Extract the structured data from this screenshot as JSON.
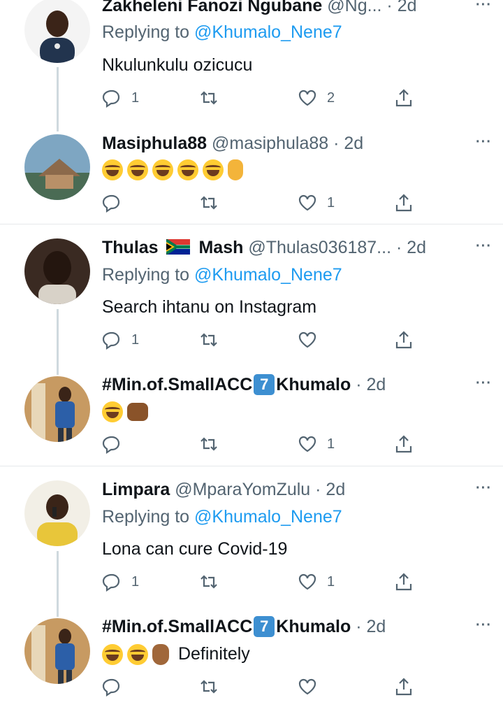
{
  "tweets": [
    {
      "name": "Zakheleni Fanozi Ngubane",
      "handle": "@Ng...",
      "time": "· 2d",
      "replying_prefix": "Replying to ",
      "replying_to": "@Khumalo_Nene7",
      "text": "Nkulunkulu ozicucu",
      "replies": "1",
      "retweets": "",
      "likes": "2"
    },
    {
      "name": "Masiphula88",
      "handle": "@masiphula88",
      "time": "· 2d",
      "emojis": [
        "rolling-on-floor-laughing",
        "rolling-on-floor-laughing",
        "rolling-on-floor-laughing",
        "rolling-on-floor-laughing",
        "rolling-on-floor-laughing",
        "ok-hand"
      ],
      "replies": "",
      "retweets": "",
      "likes": "1"
    },
    {
      "name_part1": "Thulas",
      "name_part2": "Mash",
      "flag": "south-africa-flag",
      "handle": "@Thulas036187...",
      "time": "· 2d",
      "replying_prefix": "Replying to ",
      "replying_to": "@Khumalo_Nene7",
      "text": "Search ihtanu on Instagram",
      "replies": "1",
      "retweets": "",
      "likes": ""
    },
    {
      "name_part1": "#Min.of.SmallACC",
      "keycap": "7",
      "name_part2": "Khumalo",
      "time": "· 2d",
      "emojis": [
        "face-with-tears-of-joy",
        "oncoming-fist"
      ],
      "replies": "",
      "retweets": "",
      "likes": "1"
    },
    {
      "name": "Limpara",
      "handle": "@MparaYomZulu",
      "time": "· 2d",
      "replying_prefix": "Replying to ",
      "replying_to": "@Khumalo_Nene7",
      "text": "Lona can cure Covid-19",
      "replies": "1",
      "retweets": "",
      "likes": "1"
    },
    {
      "name_part1": "#Min.of.SmallACC",
      "keycap": "7",
      "name_part2": "Khumalo",
      "time": "· 2d",
      "emojis": [
        "face-with-tears-of-joy",
        "face-with-tears-of-joy",
        "crossed-fingers"
      ],
      "text": "Definitely",
      "replies": "",
      "retweets": "",
      "likes": ""
    }
  ],
  "more_label": "···",
  "colors": {
    "link": "#1d9bf0",
    "secondary": "#536471",
    "thread_line": "#cfd9de"
  }
}
